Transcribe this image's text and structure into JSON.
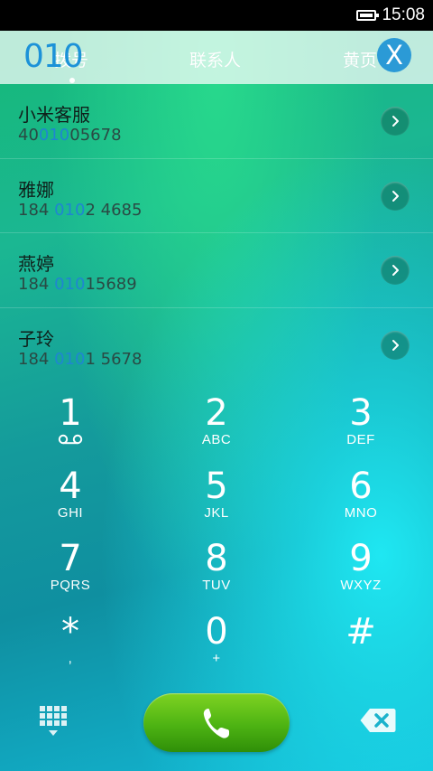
{
  "status_bar": {
    "time": "15:08"
  },
  "tabs": [
    {
      "label": "拨号"
    },
    {
      "label": "联系人"
    },
    {
      "label": "黄页"
    }
  ],
  "dial": {
    "number": "010",
    "close_label": "X"
  },
  "contacts": [
    {
      "name": "小米客服",
      "number_pre": "40",
      "number_match": "010",
      "number_post": "05678"
    },
    {
      "name": "雅娜",
      "number_pre": "184 ",
      "number_match": "010",
      "number_post": "2 4685"
    },
    {
      "name": "燕婷",
      "number_pre": "184 ",
      "number_match": "010",
      "number_post": "15689"
    },
    {
      "name": "子玲",
      "number_pre": "184 ",
      "number_match": "010",
      "number_post": "1 5678"
    }
  ],
  "keypad": [
    {
      "digit": "1",
      "letters": ""
    },
    {
      "digit": "2",
      "letters": "ABC"
    },
    {
      "digit": "3",
      "letters": "DEF"
    },
    {
      "digit": "4",
      "letters": "GHI"
    },
    {
      "digit": "5",
      "letters": "JKL"
    },
    {
      "digit": "6",
      "letters": "MNO"
    },
    {
      "digit": "7",
      "letters": "PQRS"
    },
    {
      "digit": "8",
      "letters": "TUV"
    },
    {
      "digit": "9",
      "letters": "WXYZ"
    },
    {
      "digit": "*",
      "letters": ","
    },
    {
      "digit": "0",
      "letters": "+"
    },
    {
      "digit": "#",
      "letters": ""
    }
  ],
  "icons": {
    "battery": "battery-icon",
    "voicemail": "voicemail-icon",
    "detail": "chevron-right-icon",
    "keypad": "keypad-grid-icon",
    "call": "phone-handset-icon",
    "backspace": "backspace-icon"
  },
  "colors": {
    "highlight": "#1f86d1",
    "call_button": "#4db313",
    "close_button": "#2b9ad6"
  }
}
